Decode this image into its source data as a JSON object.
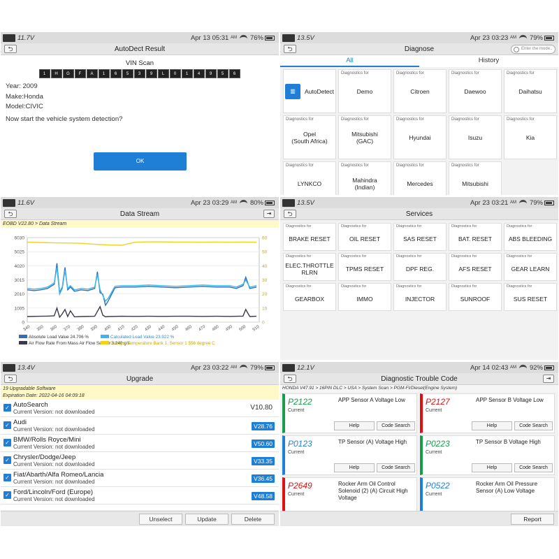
{
  "panels": {
    "autodetect": {
      "status": {
        "voltage": "11.7V",
        "time": "Apr 13 05:31",
        "am": "AM",
        "battery": "76%"
      },
      "title": "AutoDect Result",
      "vin_heading": "VIN Scan",
      "vin_chars": [
        "1",
        "H",
        "G",
        "F",
        "A",
        "1",
        "6",
        "5",
        "3",
        "9",
        "L",
        "0",
        "1",
        "4",
        "9",
        "5",
        "6"
      ],
      "year": "Year: 2009",
      "make": "Make:Honda",
      "model": "Model:CIVIC",
      "prompt": "Now start the vehicle system detection?",
      "ok_label": "OK"
    },
    "diagnose": {
      "status": {
        "voltage": "13.5V",
        "time": "Apr 23 03:23",
        "am": "AM",
        "battery": "79%"
      },
      "title": "Diagnose",
      "search_placeholder": "Enter the mode..",
      "tabs": [
        "All",
        "History"
      ],
      "autodetect_label": "AutoDetect",
      "cap": "Diagnostics for",
      "tiles": [
        "Demo",
        "Citroen",
        "Daewoo",
        "Daihatsu",
        "Opel\n(South Africa)",
        "Mitsubishi\n(GAC)",
        "Hyundai",
        "Isuzu",
        "Kia",
        "LYNKCO",
        "Mahindra\n(Indian)",
        "Mercedes",
        "Mitsubishi"
      ]
    },
    "datastream": {
      "status": {
        "voltage": "11.6V",
        "time": "Apr 23 03:29",
        "am": "AM",
        "battery": "80%"
      },
      "title": "Data Stream",
      "subhead": "EOBD V22.80 > Data Stream"
    },
    "services": {
      "status": {
        "voltage": "13.5V",
        "time": "Apr 23 03:21",
        "am": "AM",
        "battery": "79%"
      },
      "title": "Services",
      "cap": "Diagnostics for",
      "items": [
        "BRAKE RESET",
        "OIL RESET",
        "SAS RESET",
        "BAT. RESET",
        "ABS BLEEDING",
        "ELEC.THROTTLE\nRLRN",
        "TPMS RESET",
        "DPF REG.",
        "AFS RESET",
        "GEAR LEARN",
        "GEARBOX",
        "IMMO",
        "INJECTOR",
        "SUNROOF",
        "SUS RESET"
      ]
    },
    "upgrade": {
      "status": {
        "voltage": "13.4V",
        "time": "Apr 23 03:22",
        "am": "AM",
        "battery": "79%"
      },
      "title": "Upgrade",
      "count_line": "19 Upgradable Software",
      "expiration": "Expiration Date: 2022-04-16 04:09:18",
      "items": [
        {
          "name": "AutoSearch",
          "current": "Current Version: not downloaded",
          "version": "V10.80"
        },
        {
          "name": "Audi",
          "current": "Current Version: not downloaded",
          "version": "V28.76"
        },
        {
          "name": "BMW/Rolls Royce/Mini",
          "current": "Current Version: not downloaded",
          "version": "V50.60"
        },
        {
          "name": "Chrysler/Dodge/Jeep",
          "current": "Current Version: not downloaded",
          "version": "V33.35"
        },
        {
          "name": "Fiat/Abarth/Alfa Romeo/Lancia",
          "current": "Current Version: not downloaded",
          "version": "V36.45"
        },
        {
          "name": "Ford/Lincoln/Ford (Europe)",
          "current": "Current Version: not downloaded",
          "version": "V48.58"
        }
      ],
      "buttons": {
        "unselect": "Unselect",
        "update": "Update",
        "delete": "Delete"
      }
    },
    "dtc": {
      "status": {
        "voltage": "12.1V",
        "time": "Apr 14 02:43",
        "am": "AM",
        "battery": "92%"
      },
      "title": "Diagnostic Trouble Code",
      "breadcrumb": "HONDA V47.91 > 16PIN DLC > USA > System Scan > PGM-FI/Diesel(Engine System)",
      "help_label": "Help",
      "search_label": "Code Search",
      "codes": [
        {
          "code": "P2122",
          "status": "Current",
          "desc": "APP Sensor A Voltage Low",
          "color": "green"
        },
        {
          "code": "P2127",
          "status": "Current",
          "desc": "APP Sensor B Voltage Low",
          "color": "red"
        },
        {
          "code": "P0123",
          "status": "Current",
          "desc": "TP Sensor (A) Voltage High",
          "color": "blue"
        },
        {
          "code": "P0223",
          "status": "Current",
          "desc": "TP Sensor B Voltage High",
          "color": "green"
        },
        {
          "code": "P2649",
          "status": "Current",
          "desc": "Rocker Arm Oil Control Solenoid (2) (A) Circuit High Voltage",
          "color": "red"
        },
        {
          "code": "P0522",
          "status": "Current",
          "desc": "Rocker Arm Oil Pressure Sensor (A) Low Voltage",
          "color": "blue"
        }
      ],
      "report_label": "Report"
    }
  },
  "chart_data": {
    "type": "line",
    "title": "",
    "x_ticks": [
      "340",
      "350",
      "360",
      "370",
      "380",
      "390",
      "400",
      "410",
      "420",
      "430",
      "440",
      "450",
      "460",
      "470",
      "480",
      "490",
      "500",
      "510"
    ],
    "y_left_ticks": [
      "6030",
      "5025",
      "4020",
      "3015",
      "2010",
      "1005",
      "0"
    ],
    "y_right_ticks": [
      "60",
      "50",
      "40",
      "30",
      "20",
      "10",
      "0"
    ],
    "xlim": [
      340,
      512
    ],
    "ylim_left": [
      0,
      6030
    ],
    "series": [
      {
        "name": "Absolute Load Value 24.706 %",
        "color": "#2e6fb5",
        "x": [
          340,
          345,
          350,
          355,
          360,
          362,
          364,
          366,
          368,
          370,
          372,
          375,
          380,
          385,
          390,
          392,
          394,
          396,
          398,
          400,
          405,
          410,
          420,
          430,
          440,
          450,
          460,
          470,
          480,
          490,
          495,
          500,
          502,
          505,
          510
        ],
        "y": [
          2300,
          2250,
          2300,
          2400,
          2700,
          4200,
          2100,
          2500,
          3900,
          2300,
          2500,
          2200,
          2300,
          2250,
          2400,
          3600,
          2100,
          2000,
          1200,
          1500,
          2450,
          2500,
          2500,
          2550,
          2500,
          2450,
          2500,
          2550,
          2500,
          2500,
          2400,
          2600,
          3200,
          2400,
          2500
        ]
      },
      {
        "name": "Calculated Load Value 23.922 %",
        "color": "#3fb6ea",
        "x": [
          340,
          345,
          350,
          355,
          360,
          362,
          364,
          366,
          368,
          370,
          372,
          375,
          380,
          385,
          390,
          392,
          394,
          396,
          398,
          400,
          405,
          410,
          420,
          430,
          440,
          450,
          460,
          470,
          480,
          490,
          495,
          500,
          502,
          505,
          510
        ],
        "y": [
          2400,
          2350,
          2400,
          2500,
          2800,
          3900,
          2000,
          2400,
          3700,
          2400,
          2600,
          2300,
          2400,
          2350,
          2500,
          3400,
          2300,
          1900,
          1500,
          1700,
          2550,
          2600,
          2600,
          2650,
          2600,
          2550,
          2600,
          2650,
          2600,
          2600,
          2500,
          2700,
          3000,
          2500,
          2600
        ]
      },
      {
        "name": "Air Flow Rate From Mass Air Flow Sensor 3.240 g/s",
        "color": "#3a3a4a",
        "x": [
          340,
          350,
          355,
          360,
          362,
          364,
          366,
          368,
          370,
          372,
          375,
          380,
          390,
          394,
          396,
          398,
          400,
          410,
          420,
          430,
          440,
          450,
          460,
          470,
          480,
          490,
          500,
          502,
          505,
          510
        ],
        "y": [
          400,
          420,
          430,
          450,
          1000,
          350,
          600,
          900,
          400,
          800,
          380,
          400,
          420,
          1100,
          500,
          380,
          400,
          420,
          410,
          420,
          410,
          420,
          420,
          410,
          420,
          410,
          430,
          900,
          400,
          420
        ]
      },
      {
        "name": "Catalyst Temperature Bank 1, Sensor 1 556 degree C",
        "color": "#f2d21b",
        "x": [
          340,
          350,
          360,
          370,
          380,
          390,
          400,
          410,
          420,
          430,
          440,
          450,
          460,
          470,
          480,
          490,
          500,
          510
        ],
        "y": [
          5700,
          5680,
          5650,
          5640,
          5620,
          5550,
          5500,
          5480,
          5700,
          5720,
          5720,
          5710,
          5710,
          5700,
          5710,
          5700,
          5710,
          5700
        ]
      }
    ]
  }
}
